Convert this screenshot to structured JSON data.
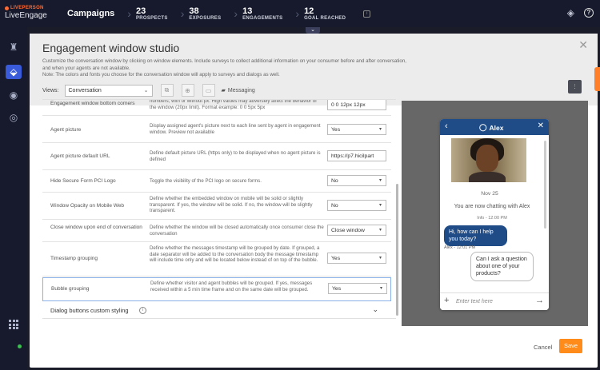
{
  "brand": {
    "top": "LIVEPERSON",
    "product": "LiveEngage"
  },
  "topbar": {
    "section": "Campaigns",
    "stats": [
      {
        "value": "23",
        "label": "PROSPECTS"
      },
      {
        "value": "38",
        "label": "EXPOSURES"
      },
      {
        "value": "13",
        "label": "ENGAGEMENTS"
      },
      {
        "value": "12",
        "label": "GOAL REACHED"
      }
    ]
  },
  "modal": {
    "title": "Engagement window studio",
    "description_1": "Customize the conversation window by clicking on window elements. Include surveys to collect additional information on your consumer before and after conversation,",
    "description_2": "and when your agents are not available.",
    "description_3": "Note: The colors and fonts you choose for the conversation window will apply to surveys and dialogs as well.",
    "views_label": "Views:",
    "views_value": "Conversation",
    "messaging_label": "Messaging"
  },
  "settings": [
    {
      "name": "Engagement window bottom corners",
      "desc": "numbers, with or without px. High values may adversely affect the behavior of the window (20px limit). Format example: 0 0 5px 5px",
      "value": "0 0 12px 12px",
      "kind": "input"
    },
    {
      "name": "Agent picture",
      "desc": "Display assigned agent's picture next to each line sent by agent in engagement window. Preview not available",
      "value": "Yes",
      "kind": "select"
    },
    {
      "name": "Agent picture default URL",
      "desc": "Define default picture URL (https only) to be displayed when no agent picture is defined",
      "value": "https://p7.hicilpart",
      "kind": "input"
    },
    {
      "name": "Hide Secure Form PCI Logo",
      "desc": "Toggle the visibility of the PCI logo on secure forms.",
      "value": "No",
      "kind": "select"
    },
    {
      "name": "Window Opacity on Mobile Web",
      "desc": "Define whether the embedded window on mobile will be solid or slightly transparent. If yes, the window will be solid. If no, the window will be slightly transparent.",
      "value": "No",
      "kind": "select"
    },
    {
      "name": "Close window upon end of conversation",
      "desc": "Define whether the window will be closed automatically once consumer close the conversation",
      "value": "Close window",
      "kind": "select"
    },
    {
      "name": "Timestamp grouping",
      "desc": "Define whether the messages timestamp will be grouped by date. If grouped, a date separator will be added to the conversation body the message timestamp will include time only and will be located below instead of on top of the bubble.",
      "value": "Yes",
      "kind": "select"
    },
    {
      "name": "Bubble grouping",
      "desc": "Define whether visitor and agent bubbles will be grouped. If yes, messages received within a 5 min time frame and on the same date will be grouped.",
      "value": "Yes",
      "kind": "select"
    }
  ],
  "dialog_section": {
    "title": "Dialog buttons custom styling"
  },
  "preview": {
    "agent_name": "Alex",
    "date": "Nov 25",
    "system_message": "You are now chatting with Alex",
    "system_timestamp": "Info - 12:00 PM",
    "agent_message": "Hi, how can I help you today?",
    "agent_timestamp": "Alex - 12:01 PM",
    "visitor_message": "Can I ask a question about one of your products?",
    "input_placeholder": "Enter text here"
  },
  "footer": {
    "cancel": "Cancel",
    "save": "Save"
  }
}
